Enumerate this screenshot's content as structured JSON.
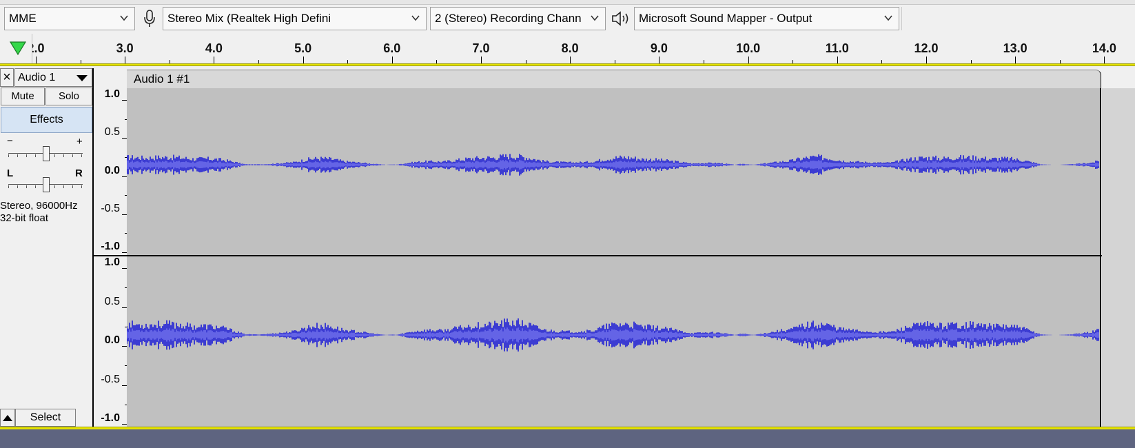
{
  "device_toolbar": {
    "host": "MME",
    "recording_device": "Stereo Mix (Realtek High Defini",
    "recording_channels": "2 (Stereo) Recording Chann",
    "playback_device": "Microsoft Sound Mapper - Output",
    "icons": [
      "microphone-icon",
      "speaker-icon",
      "chevron-down-icon"
    ]
  },
  "timeline": {
    "labels": [
      "2.0",
      "3.0",
      "4.0",
      "5.0",
      "6.0",
      "7.0",
      "8.0",
      "9.0",
      "10.0",
      "11.0",
      "12.0",
      "13.0",
      "14.0"
    ]
  },
  "track": {
    "close_label": "×",
    "name": "Audio 1",
    "mute_label": "Mute",
    "solo_label": "Solo",
    "effects_label": "Effects",
    "gain_minus": "−",
    "gain_plus": "+",
    "pan_left": "L",
    "pan_right": "R",
    "format_line1": "Stereo, 96000Hz",
    "format_line2": "32-bit float",
    "select_label": "Select"
  },
  "clip": {
    "name": "Audio 1 #1"
  },
  "vertical_ruler": {
    "labels": [
      "1.0",
      "0.5",
      "0.0",
      "-0.5",
      "-1.0"
    ]
  },
  "colors": {
    "waveform": "#3c3cd2",
    "waveform_rms": "#6464e6",
    "clip_background": "#c0c0c0",
    "playline": "#e4e200"
  }
}
